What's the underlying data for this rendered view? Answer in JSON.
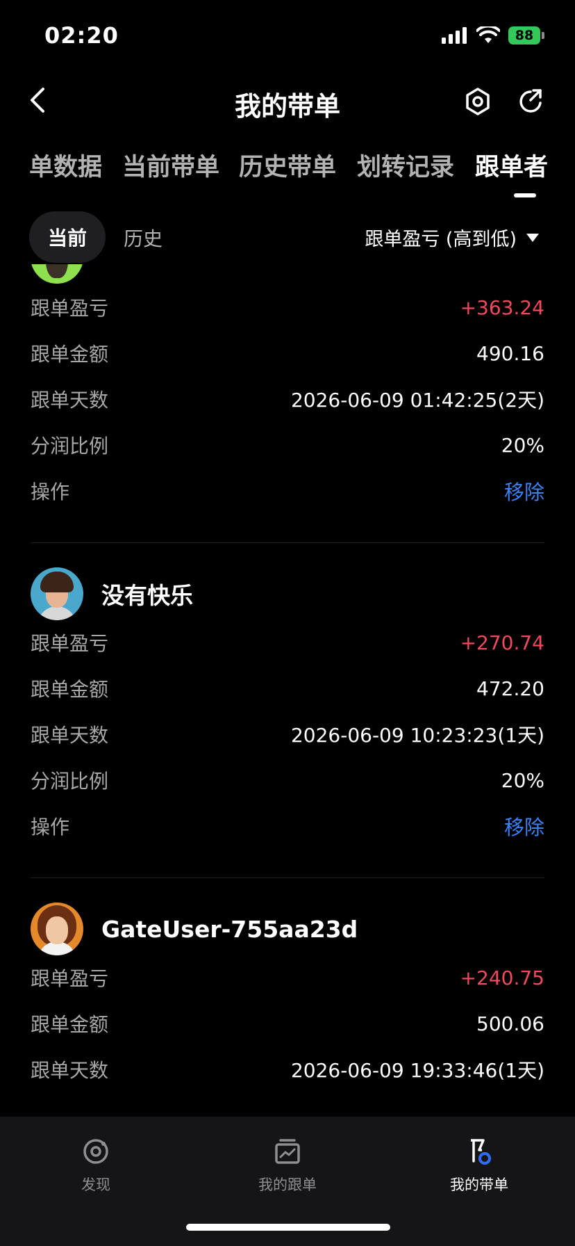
{
  "status_bar": {
    "time": "02:20",
    "battery": "88"
  },
  "nav": {
    "title": "我的带单"
  },
  "tabs": [
    {
      "label": "单数据"
    },
    {
      "label": "当前带单"
    },
    {
      "label": "历史带单"
    },
    {
      "label": "划转记录"
    },
    {
      "label": "跟单者"
    }
  ],
  "subtabs": {
    "current": "当前",
    "history": "历史",
    "sort_label": "跟单盈亏 (高到低)"
  },
  "labels": {
    "pnl": "跟单盈亏",
    "amount": "跟单金额",
    "days": "跟单天数",
    "share_ratio": "分润比例",
    "action": "操作"
  },
  "followers": [
    {
      "name": "",
      "pnl": "+363.24",
      "amount": "490.16",
      "days": "2026-06-09 01:42:25(2天)",
      "share_ratio": "20%",
      "action": "移除"
    },
    {
      "name": "没有快乐",
      "pnl": "+270.74",
      "amount": "472.20",
      "days": "2026-06-09 10:23:23(1天)",
      "share_ratio": "20%",
      "action": "移除"
    },
    {
      "name": "GateUser-755aa23d",
      "pnl": "+240.75",
      "amount": "500.06",
      "days": "2026-06-09 19:33:46(1天)"
    }
  ],
  "tabbar": [
    {
      "label": "发现",
      "icon": "discover-icon"
    },
    {
      "label": "我的跟单",
      "icon": "chart-box-icon"
    },
    {
      "label": "我的带单",
      "icon": "lead-trade-icon"
    }
  ],
  "colors": {
    "profit": "#f2495c",
    "link": "#3b82f6",
    "battery": "#34c759"
  }
}
